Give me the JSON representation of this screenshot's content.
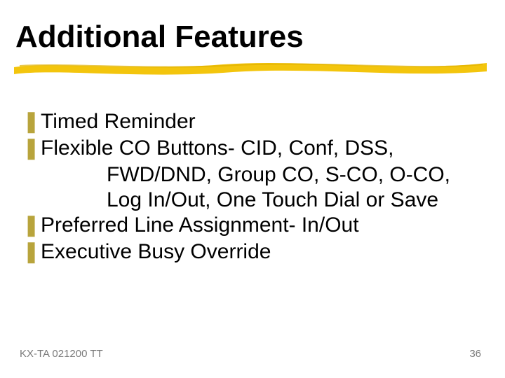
{
  "title": "Additional Features",
  "bullets": {
    "b1": "Timed Reminder",
    "b2": "Flexible CO Buttons- CID, Conf, DSS,",
    "b2_line2": "FWD/DND, Group CO, S-CO, O-CO,",
    "b2_line3": "Log In/Out, One Touch Dial or Save",
    "b3": "Preferred Line Assignment- In/Out",
    "b4": "Executive Busy Override"
  },
  "bullet_glyph": "❚",
  "footer": {
    "left": "KX-TA 021200 TT",
    "right": "36"
  },
  "colors": {
    "accent": "#b8a43c",
    "underline": "#f2c200"
  }
}
